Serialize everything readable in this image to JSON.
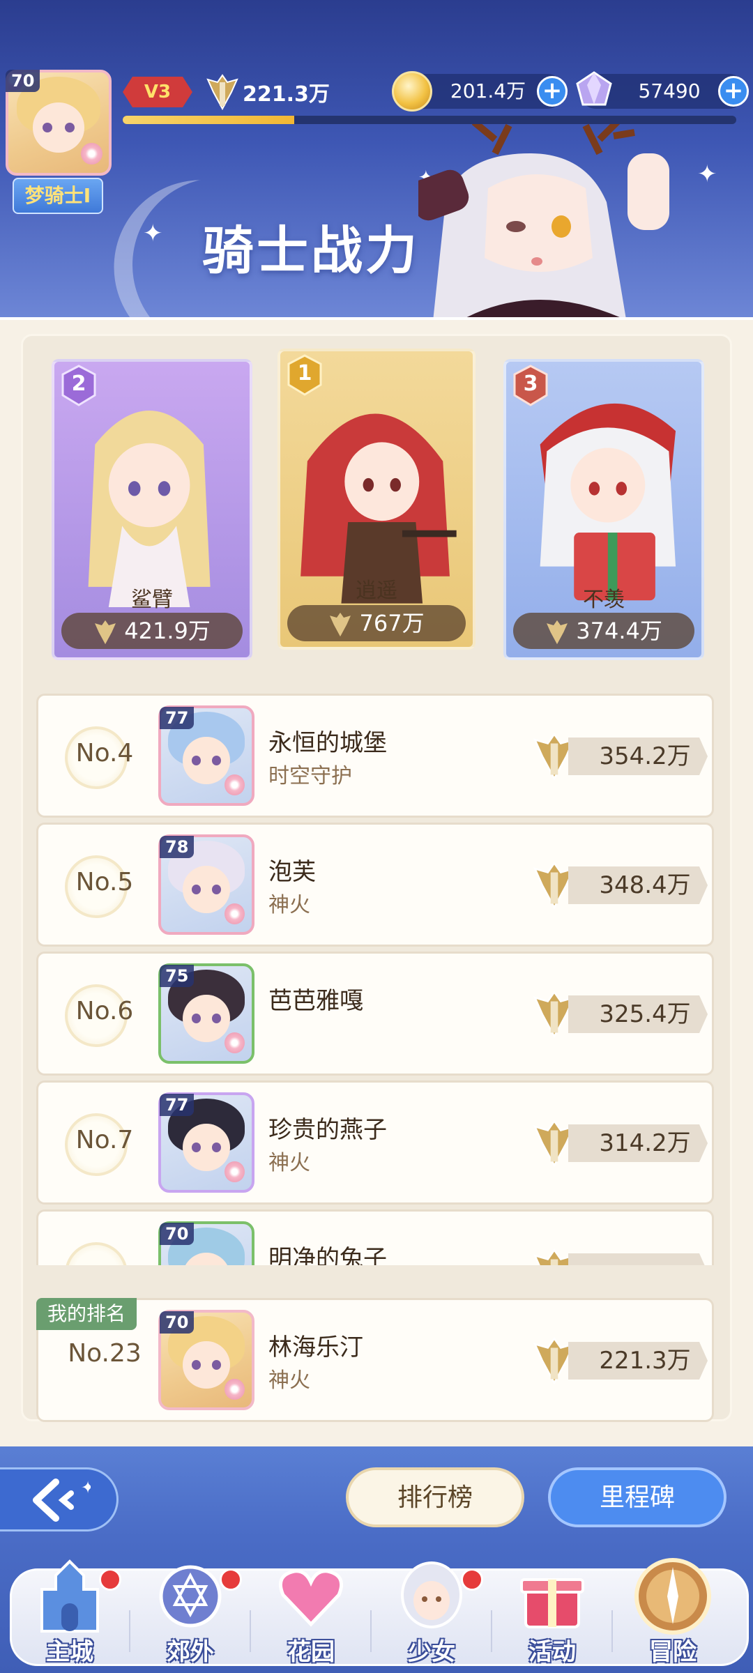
{
  "header": {
    "player_level": "70",
    "player_title": "梦骑士Ⅰ",
    "vip": "V3",
    "power": "221.3万",
    "xp_fraction": 0.28,
    "gold": "201.4万",
    "gems": "57490",
    "page_title": "骑士战力"
  },
  "podium": [
    {
      "rank": "2",
      "name": "鲨臂",
      "power": "421.9万"
    },
    {
      "rank": "1",
      "name": "逍遥",
      "power": "767万"
    },
    {
      "rank": "3",
      "name": "不羡",
      "power": "374.4万"
    }
  ],
  "ranking": [
    {
      "rank": "No.4",
      "level": "77",
      "name": "永恒的城堡",
      "guild": "时空守护",
      "power": "354.2万"
    },
    {
      "rank": "No.5",
      "level": "78",
      "name": "泡芙",
      "guild": "神火",
      "power": "348.4万"
    },
    {
      "rank": "No.6",
      "level": "75",
      "name": "芭芭雅嘎",
      "guild": "",
      "power": "325.4万"
    },
    {
      "rank": "No.7",
      "level": "77",
      "name": "珍贵的燕子",
      "guild": "神火",
      "power": "314.2万"
    },
    {
      "rank": "",
      "level": "70",
      "name": "明净的兔子",
      "guild": "",
      "power": ""
    }
  ],
  "my_rank": {
    "tag": "我的排名",
    "rank": "No.23",
    "level": "70",
    "name": "林海乐汀",
    "guild": "神火",
    "power": "221.3万"
  },
  "buttons": {
    "leaderboard": "排行榜",
    "milestone": "里程碑"
  },
  "nav": [
    {
      "label": "主城",
      "icon": "castle-icon",
      "badge": true
    },
    {
      "label": "郊外",
      "icon": "portal-icon",
      "badge": true
    },
    {
      "label": "花园",
      "icon": "heart-icon",
      "badge": false
    },
    {
      "label": "少女",
      "icon": "girl-icon",
      "badge": true
    },
    {
      "label": "活动",
      "icon": "gift-icon",
      "badge": false
    },
    {
      "label": "冒险",
      "icon": "compass-icon",
      "badge": false
    }
  ],
  "colors": {
    "accent_blue": "#4d8cf0",
    "gold": "#f2c244",
    "badge_red": "#e63b3b",
    "my_rank_green": "#6a9e6f"
  }
}
